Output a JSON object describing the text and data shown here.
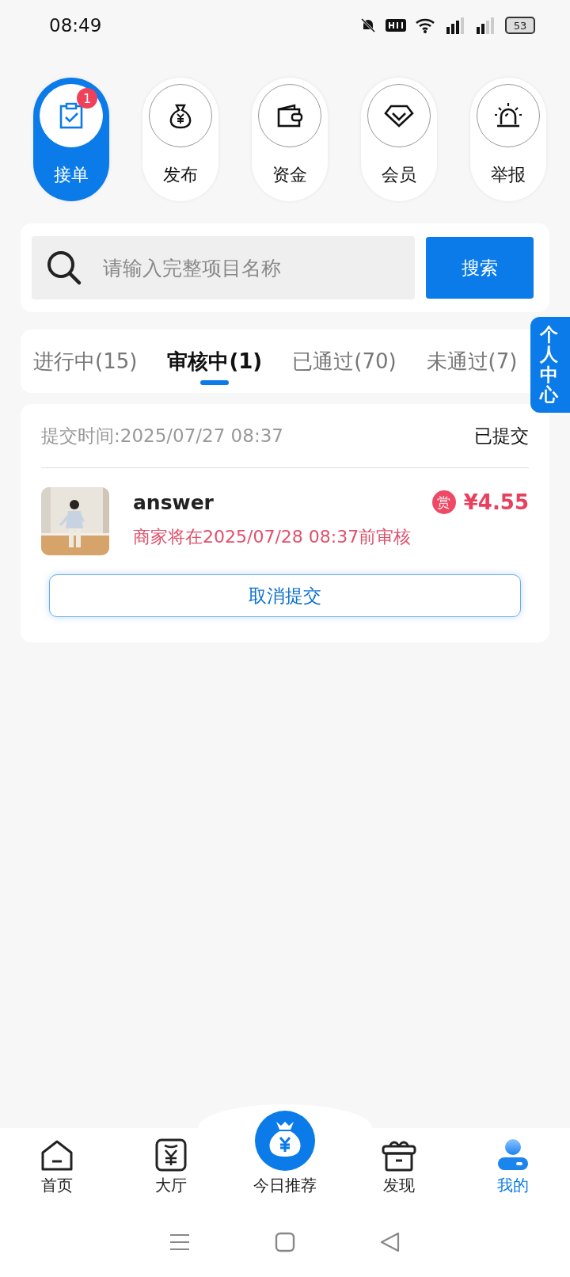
{
  "status_bar": {
    "time": "08:49",
    "battery": "53"
  },
  "shortcuts": [
    {
      "kind": "clipboard",
      "label": "接单",
      "selected": true,
      "badge": "1"
    },
    {
      "kind": "moneybag",
      "label": "发布",
      "selected": false
    },
    {
      "kind": "wallet",
      "label": "资金",
      "selected": false
    },
    {
      "kind": "diamond",
      "label": "会员",
      "selected": false
    },
    {
      "kind": "alarm",
      "label": "举报",
      "selected": false
    }
  ],
  "search": {
    "placeholder": "请输入完整项目名称",
    "button": "搜索"
  },
  "tabs": [
    {
      "label": "进行中(15)",
      "selected": false
    },
    {
      "label": "审核中(1)",
      "selected": true
    },
    {
      "label": "已通过(70)",
      "selected": false
    },
    {
      "label": "未通过(7)",
      "selected": false
    }
  ],
  "side_tab": "个人中心",
  "task": {
    "submit_time": "提交时间:2025/07/27 08:37",
    "status": "已提交",
    "title": "answer",
    "reward_badge": "赏",
    "price": "¥4.55",
    "deadline": "商家将在2025/07/28 08:37前审核",
    "cancel_button": "取消提交"
  },
  "bottom_nav": [
    {
      "kind": "home",
      "label": "首页",
      "selected": false
    },
    {
      "kind": "hall",
      "label": "大厅",
      "selected": false
    },
    {
      "kind": "featured",
      "label": "今日推荐",
      "selected": false
    },
    {
      "kind": "discover",
      "label": "发现",
      "selected": false
    },
    {
      "kind": "profile",
      "label": "我的",
      "selected": true
    }
  ]
}
